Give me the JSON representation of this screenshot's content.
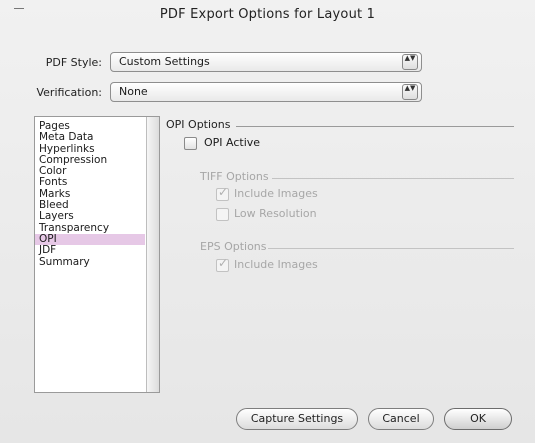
{
  "window": {
    "title": "PDF Export Options for Layout 1"
  },
  "form": {
    "pdf_style_label": "PDF Style:",
    "pdf_style_value": "Custom Settings",
    "verification_label": "Verification:",
    "verification_value": "None",
    "popup_arrows": "▲▼"
  },
  "sidebar": {
    "items": [
      {
        "label": "Pages"
      },
      {
        "label": "Meta Data"
      },
      {
        "label": "Hyperlinks"
      },
      {
        "label": "Compression"
      },
      {
        "label": "Color"
      },
      {
        "label": "Fonts"
      },
      {
        "label": "Marks"
      },
      {
        "label": "Bleed"
      },
      {
        "label": "Layers"
      },
      {
        "label": "Transparency"
      },
      {
        "label": "OPI"
      },
      {
        "label": "JDF"
      },
      {
        "label": "Summary"
      }
    ],
    "selected": "OPI",
    "selected_color": "#e6c8e6"
  },
  "opi": {
    "section_title": "OPI Options",
    "opi_active_label": "OPI Active",
    "opi_active_checked": false,
    "tiff_title": "TIFF Options",
    "tiff_include_images": "Include Images",
    "tiff_include_checked": true,
    "tiff_low_resolution": "Low Resolution",
    "tiff_low_checked": false,
    "eps_title": "EPS Options",
    "eps_include_images": "Include Images",
    "eps_include_checked": true,
    "check_glyph": "✓"
  },
  "buttons": {
    "capture": "Capture Settings",
    "cancel": "Cancel",
    "ok": "OK"
  }
}
